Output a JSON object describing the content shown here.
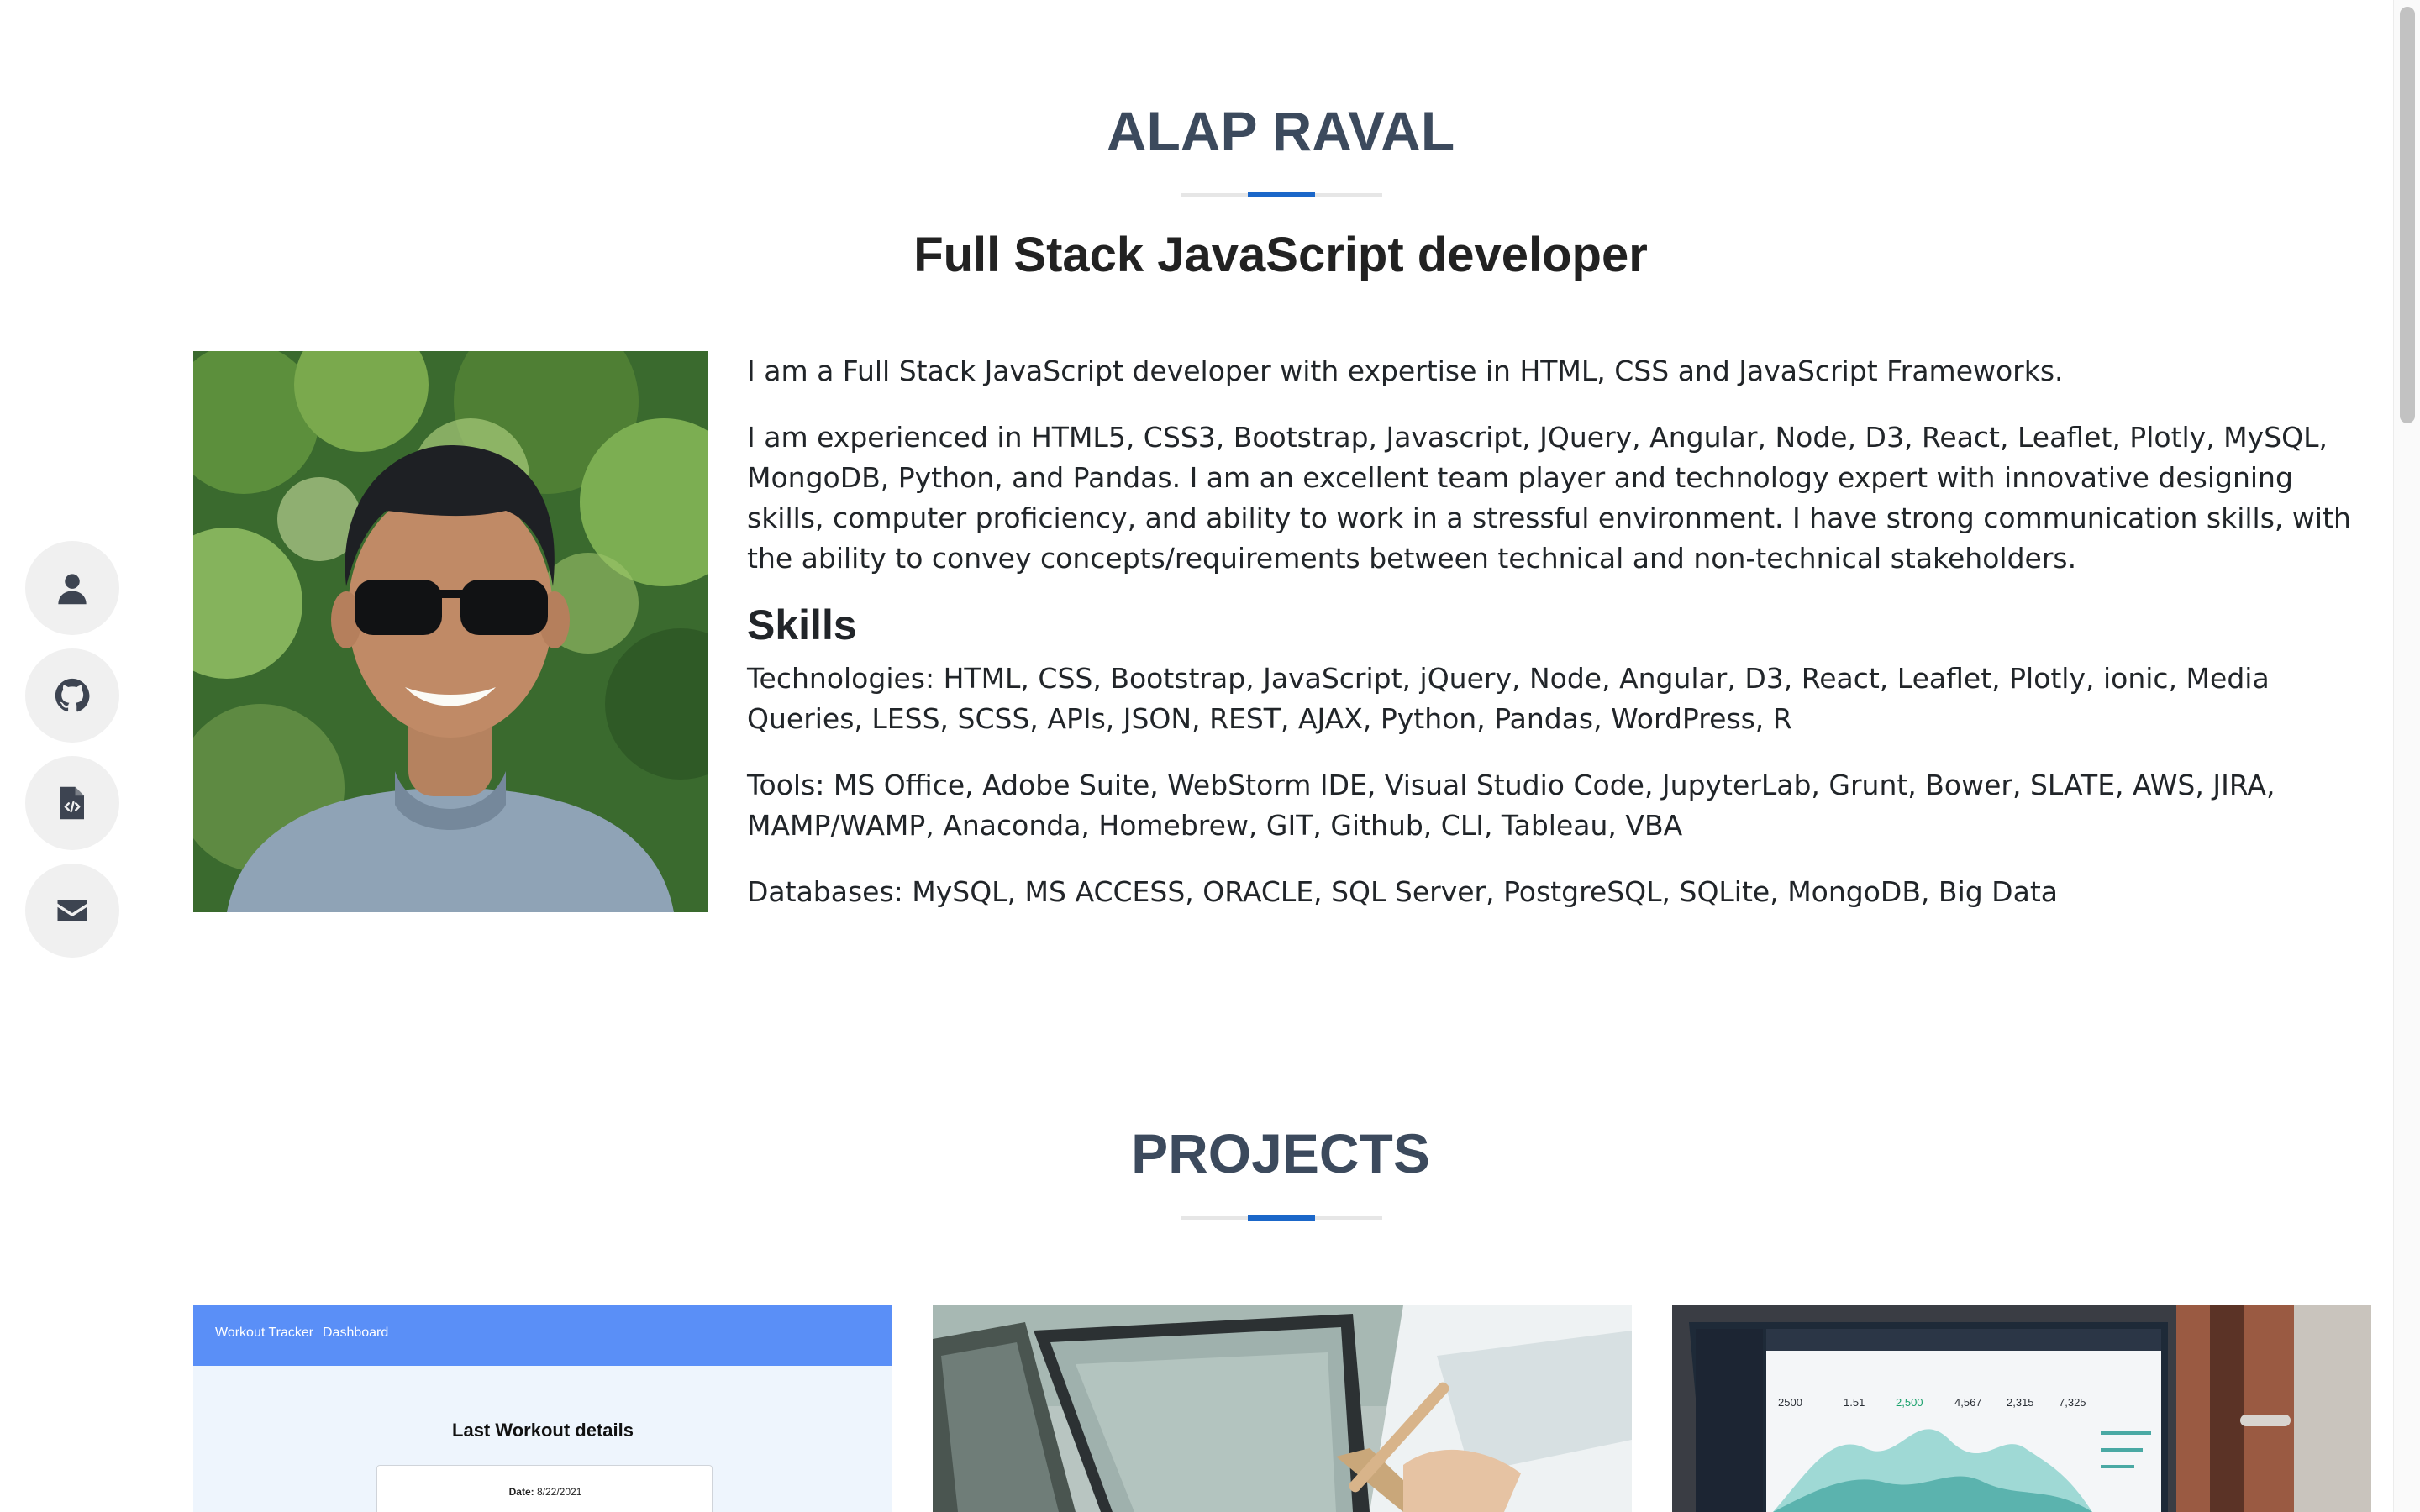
{
  "header": {
    "name": "ALAP RAVAL",
    "subtitle": "Full Stack JavaScript developer"
  },
  "side_nav": [
    {
      "icon": "user-icon",
      "label": "About"
    },
    {
      "icon": "github-icon",
      "label": "GitHub"
    },
    {
      "icon": "resume-file-icon",
      "label": "Resume"
    },
    {
      "icon": "envelope-icon",
      "label": "Email"
    }
  ],
  "about": {
    "intro": "I am a Full Stack JavaScript developer with expertise in HTML, CSS and JavaScript Frameworks.",
    "experience": "I am experienced in HTML5, CSS3, Bootstrap, Javascript, JQuery, Angular, Node, D3, React, Leaflet, Plotly, MySQL, MongoDB, Python, and Pandas. I am an excellent team player and technology expert with innovative designing skills, computer proficiency, and ability to work in a stressful environment. I have strong communication skills, with the ability to convey concepts/requirements between technical and non-technical stakeholders.",
    "skills_heading": "Skills",
    "technologies": "Technologies: HTML, CSS, Bootstrap, JavaScript, jQuery, Node, Angular, D3, React, Leaflet, Plotly, ionic, Media Queries, LESS, SCSS, APIs, JSON, REST, AJAX, Python, Pandas, WordPress, R",
    "tools": "Tools: MS Office, Adobe Suite, WebStorm IDE, Visual Studio Code, JupyterLab, Grunt, Bower, SLATE, AWS, JIRA, MAMP/WAMP, Anaconda, Homebrew, GIT, Github, CLI, Tableau, VBA",
    "databases": "Databases: MySQL, MS ACCESS, ORACLE, SQL Server, PostgreSQL, SQLite, MongoDB, Big Data"
  },
  "projects": {
    "title": "PROJECTS",
    "workout_tracker": {
      "nav_brand": "Workout Tracker",
      "nav_link": "Dashboard",
      "heading": "Last Workout details",
      "date_label": "Date:",
      "date_value": "8/22/2021"
    },
    "dashboard_tiles": [
      "2500",
      "1.51",
      "2,500",
      "4,567",
      "2,315",
      "7,325"
    ]
  },
  "colors": {
    "heading": "#3c4a5d",
    "accent": "#1b67c9",
    "nav_button_bg": "#f0f0f0",
    "workout_nav": "#5a8ff7"
  }
}
